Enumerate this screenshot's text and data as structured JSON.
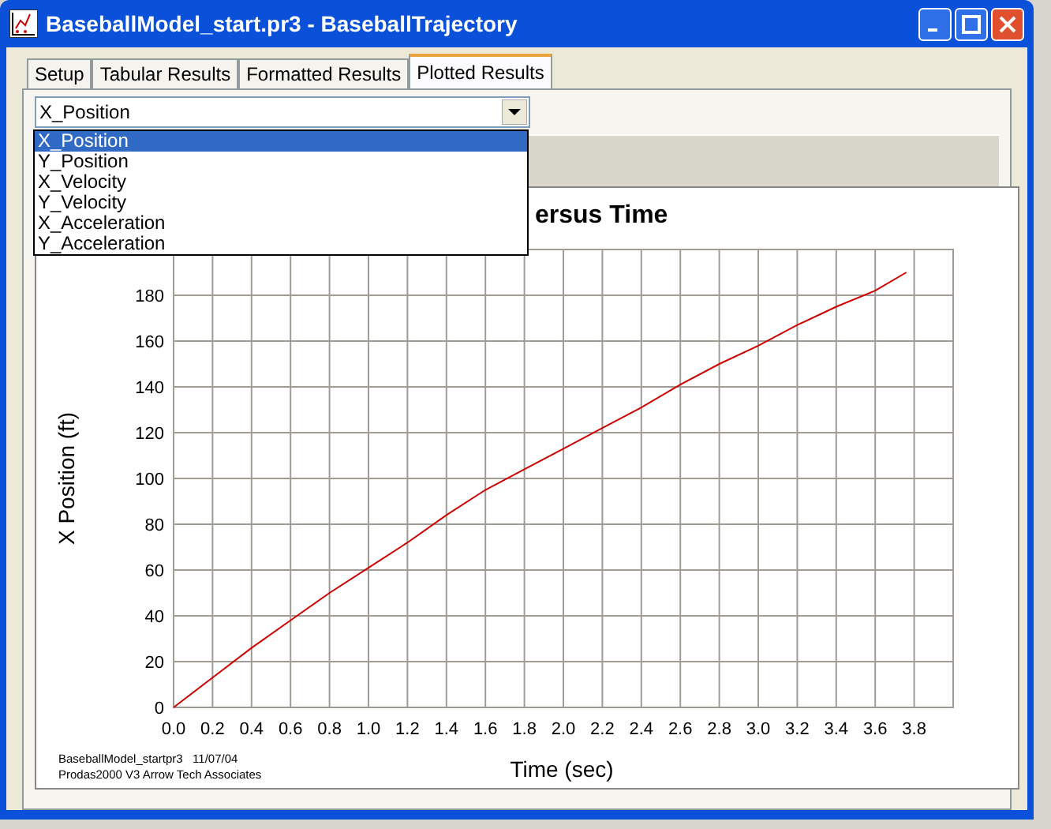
{
  "window": {
    "title": "BaseballModel_start.pr3 - BaseballTrajectory"
  },
  "tabs": [
    {
      "label": "Setup",
      "selected": false
    },
    {
      "label": "Tabular Results",
      "selected": false
    },
    {
      "label": "Formatted Results",
      "selected": false
    },
    {
      "label": "Plotted Results",
      "selected": true
    }
  ],
  "variable_select": {
    "value": "X_Position",
    "options": [
      {
        "label": "X_Position",
        "selected": true
      },
      {
        "label": "Y_Position",
        "selected": false
      },
      {
        "label": "X_Velocity",
        "selected": false
      },
      {
        "label": "Y_Velocity",
        "selected": false
      },
      {
        "label": "X_Acceleration",
        "selected": false
      },
      {
        "label": "Y_Acceleration",
        "selected": false
      }
    ]
  },
  "plot": {
    "footer": [
      "BaseballModel_startpr3   11/07/04",
      "Prodas2000 V3 Arrow Tech Associates"
    ],
    "chart_data": {
      "type": "line",
      "grid": true,
      "title": "ersus Time",
      "xlabel": "Time (sec)",
      "ylabel": "X Position (ft)",
      "xlim": [
        0,
        4
      ],
      "ylim": [
        0,
        200
      ],
      "xticks": [
        {
          "value": 0,
          "label": "0.0"
        },
        {
          "value": 0.2,
          "label": "0.2"
        },
        {
          "value": 0.4,
          "label": "0.4"
        },
        {
          "value": 0.6,
          "label": "0.6"
        },
        {
          "value": 0.8,
          "label": "0.8"
        },
        {
          "value": 1,
          "label": "1.0"
        },
        {
          "value": 1.2,
          "label": "1.2"
        },
        {
          "value": 1.4,
          "label": "1.4"
        },
        {
          "value": 1.6,
          "label": "1.6"
        },
        {
          "value": 1.8,
          "label": "1.8"
        },
        {
          "value": 2,
          "label": "2.0"
        },
        {
          "value": 2.2,
          "label": "2.2"
        },
        {
          "value": 2.4,
          "label": "2.4"
        },
        {
          "value": 2.6,
          "label": "2.6"
        },
        {
          "value": 2.8,
          "label": "2.8"
        },
        {
          "value": 3,
          "label": "3.0"
        },
        {
          "value": 3.2,
          "label": "3.2"
        },
        {
          "value": 3.4,
          "label": "3.4"
        },
        {
          "value": 3.6,
          "label": "3.6"
        },
        {
          "value": 3.8,
          "label": "3.8"
        }
      ],
      "yticks": [
        0,
        20,
        40,
        60,
        80,
        100,
        120,
        140,
        160,
        180
      ],
      "x": [
        0,
        0.2,
        0.4,
        0.6,
        0.8,
        1.0,
        1.2,
        1.4,
        1.6,
        1.8,
        2.0,
        2.2,
        2.4,
        2.6,
        2.8,
        3.0,
        3.2,
        3.4,
        3.6,
        3.76
      ],
      "series": [
        {
          "color": "#cc0000",
          "values": [
            0,
            13,
            26,
            38,
            50,
            61,
            72,
            84,
            95,
            104,
            113,
            122,
            131,
            141,
            150,
            158,
            167,
            175,
            182,
            190
          ]
        }
      ]
    }
  }
}
